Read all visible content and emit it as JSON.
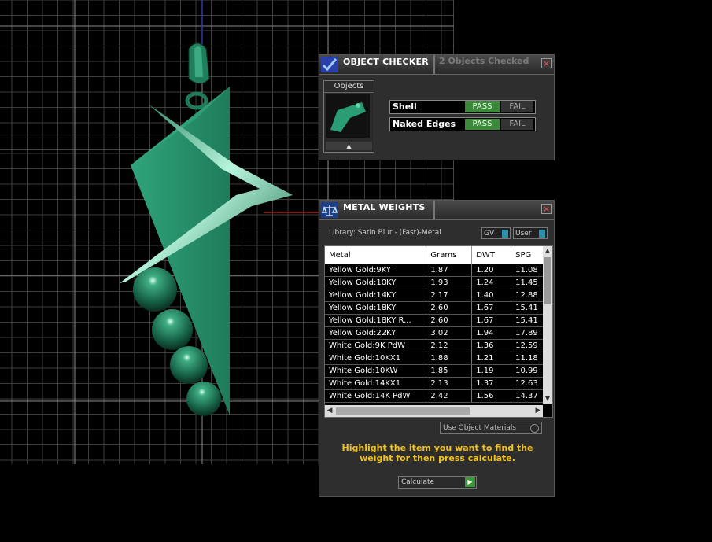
{
  "object_checker": {
    "title": "OBJECT CHECKER",
    "checked_status": "2  Objects Checked",
    "close": "×",
    "objects_label": "Objects",
    "objects_up": "▲",
    "checks": [
      {
        "name": "Shell",
        "pass": "PASS",
        "fail": "FAIL",
        "result": "PASS"
      },
      {
        "name": "Naked Edges",
        "pass": "PASS",
        "fail": "FAIL",
        "result": "PASS"
      }
    ]
  },
  "metal_weights": {
    "title": "METAL WEIGHTS",
    "close": "×",
    "library": "Library: Satin Blur - (Fast)-Metal",
    "toggle_gv": "GV",
    "toggle_user": "User",
    "columns": [
      "Metal",
      "Grams",
      "DWT",
      "SPG"
    ],
    "rows": [
      [
        "Yellow Gold:9KY",
        "1.87",
        "1.20",
        "11.08"
      ],
      [
        "Yellow Gold:10KY",
        "1.93",
        "1.24",
        "11.45"
      ],
      [
        "Yellow Gold:14KY",
        "2.17",
        "1.40",
        "12.88"
      ],
      [
        "Yellow Gold:18KY",
        "2.60",
        "1.67",
        "15.41"
      ],
      [
        "Yellow Gold:18KY R...",
        "2.60",
        "1.67",
        "15.41"
      ],
      [
        "Yellow Gold:22KY",
        "3.02",
        "1.94",
        "17.89"
      ],
      [
        "White Gold:9K PdW",
        "2.12",
        "1.36",
        "12.59"
      ],
      [
        "White Gold:10KX1",
        "1.88",
        "1.21",
        "11.18"
      ],
      [
        "White Gold:10KW",
        "1.85",
        "1.19",
        "10.99"
      ],
      [
        "White Gold:14KX1",
        "2.13",
        "1.37",
        "12.63"
      ],
      [
        "White Gold:14K PdW",
        "2.42",
        "1.56",
        "14.37"
      ]
    ],
    "use_object_materials": "Use Object Materials",
    "hint": "Highlight the item you want to find the weight for then press calculate.",
    "calculate": "Calculate"
  },
  "colors": {
    "model": "#2a9d75",
    "grid": "#5a5a5a",
    "pass_green": "#3a8a3a",
    "hint_yellow": "#f2c21a"
  }
}
